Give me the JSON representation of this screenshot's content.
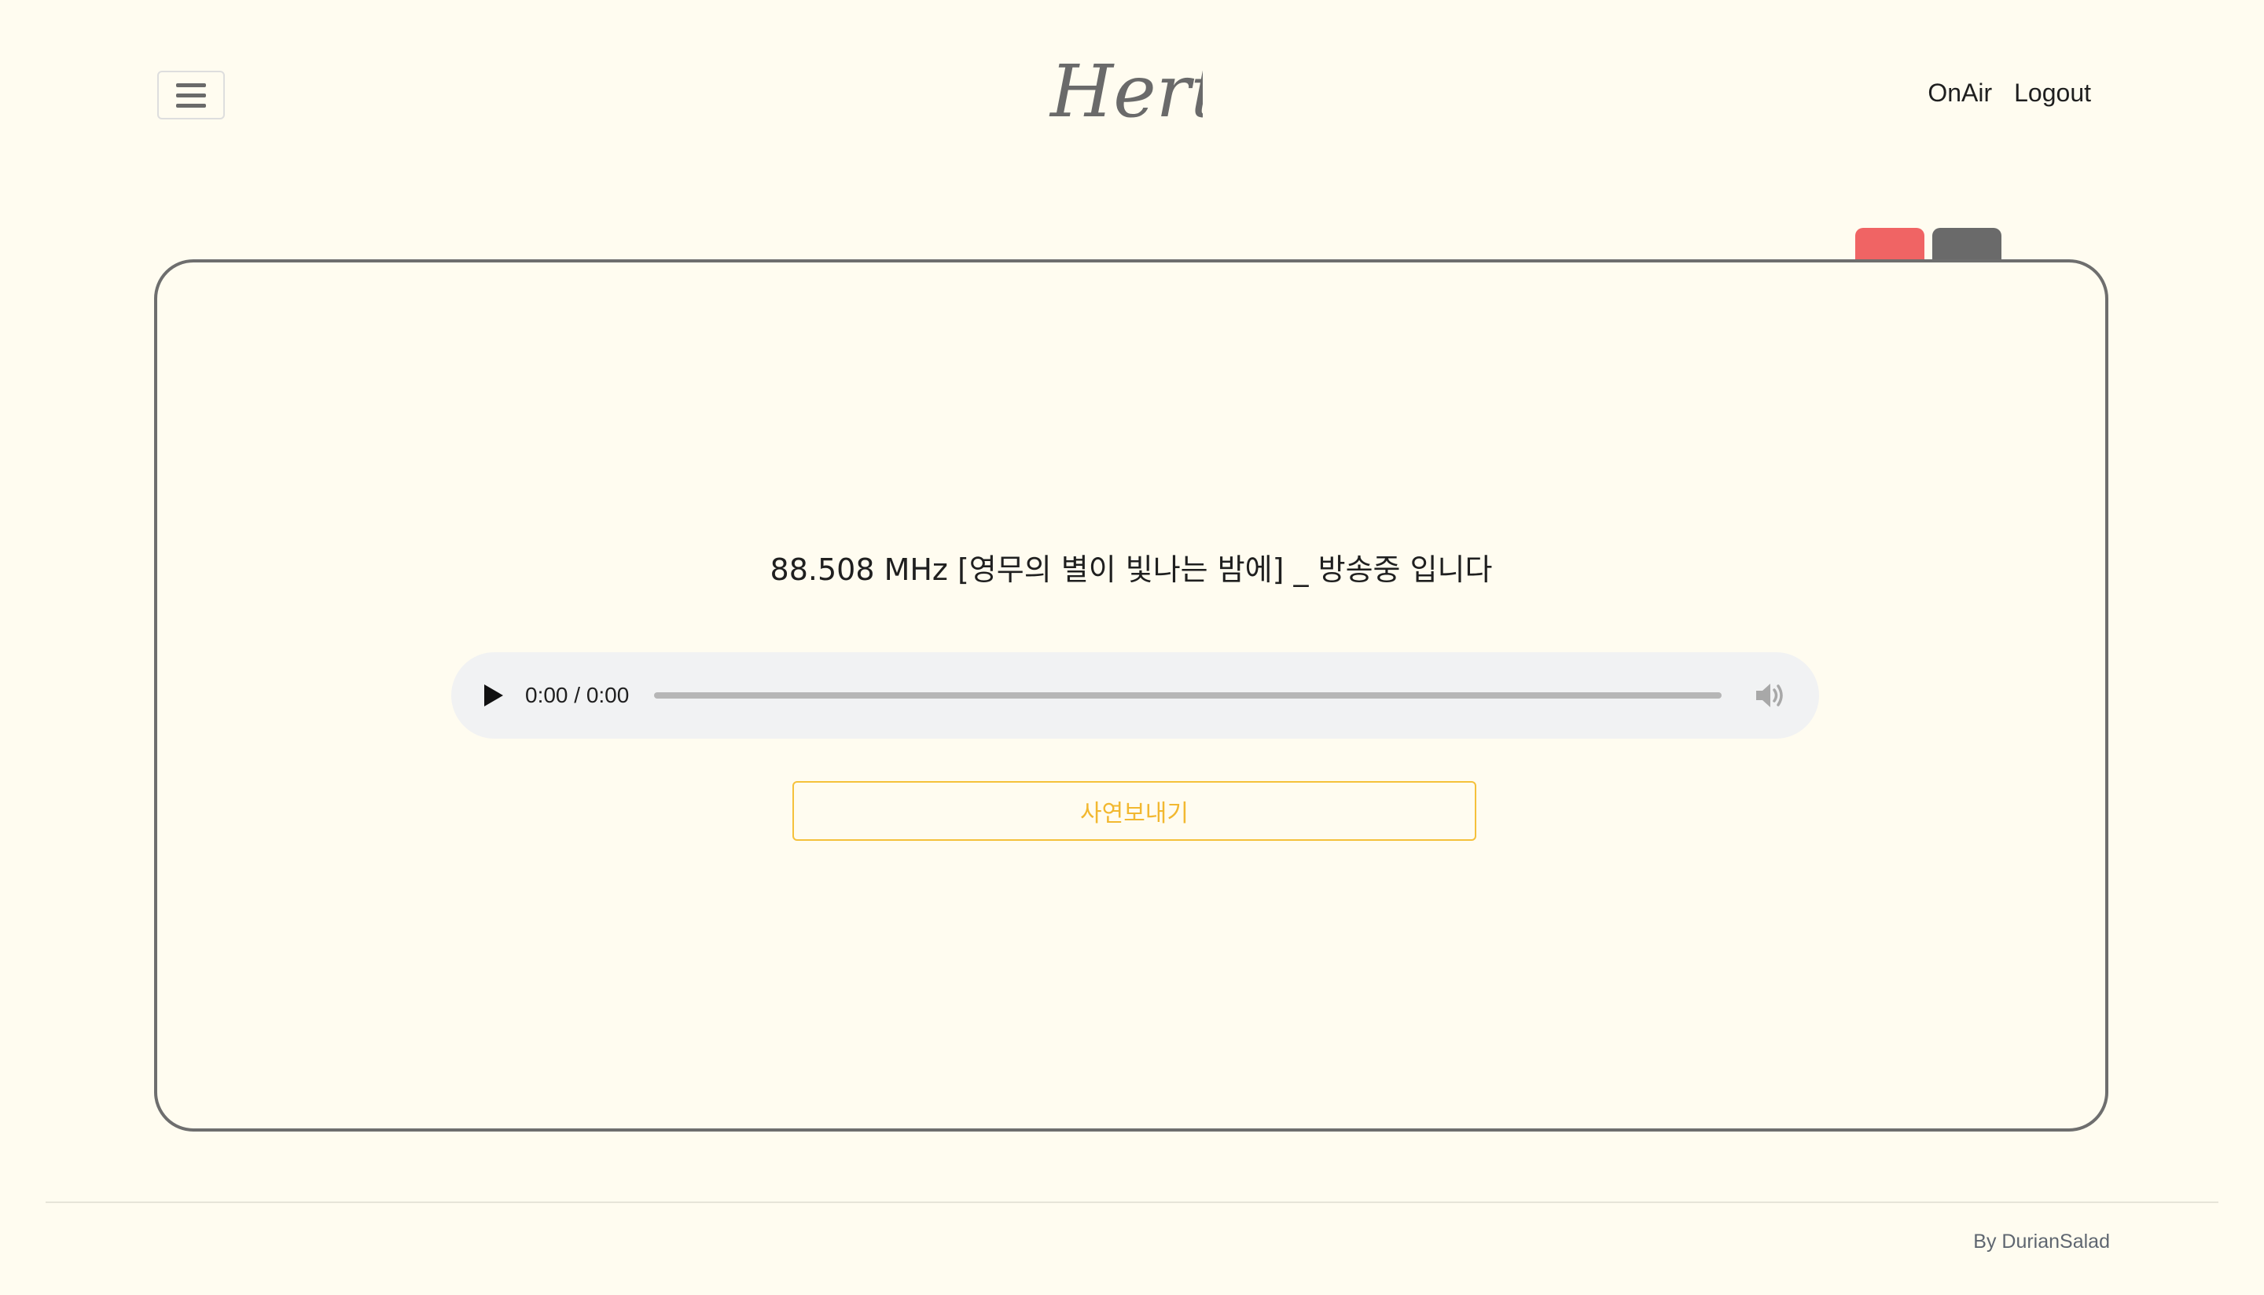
{
  "header": {
    "logo_text": "Hertz",
    "nav": [
      {
        "label": "OnAir"
      },
      {
        "label": "Logout"
      }
    ]
  },
  "tabs": {
    "colors": [
      "#f06464",
      "#6a6a6a"
    ]
  },
  "player": {
    "broadcast_title": "88.508 MHz  [영무의 별이 빛나는 밤에] _ 방송중 입니다",
    "time_display": "0:00 / 0:00",
    "progress": 0
  },
  "actions": {
    "send_story_label": "사연보내기"
  },
  "footer": {
    "credit": "By DurianSalad"
  },
  "colors": {
    "background": "#fffcf0",
    "accent": "#f5c13b",
    "border": "#6e6e6e"
  }
}
